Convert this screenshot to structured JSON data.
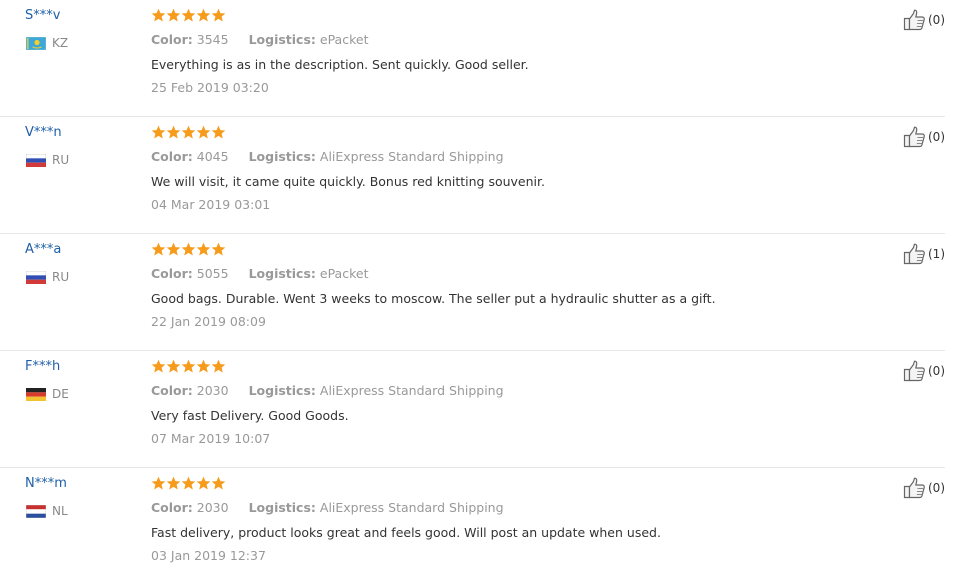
{
  "reviews": [
    {
      "user": "S***v",
      "country": "KZ",
      "flag": "kz",
      "stars": 5,
      "color_label": "Color:",
      "color_value": "3545",
      "logistics_label": "Logistics:",
      "logistics_value": "ePacket",
      "text": "Everything is as in the description. Sent quickly. Good seller.",
      "date": "25 Feb 2019 03:20",
      "helpful": "(0)"
    },
    {
      "user": "V***n",
      "country": "RU",
      "flag": "ru",
      "stars": 5,
      "color_label": "Color:",
      "color_value": "4045",
      "logistics_label": "Logistics:",
      "logistics_value": "AliExpress Standard Shipping",
      "text": "We will visit, it came quite quickly. Bonus red knitting souvenir.",
      "date": "04 Mar 2019 03:01",
      "helpful": "(0)"
    },
    {
      "user": "A***a",
      "country": "RU",
      "flag": "ru",
      "stars": 5,
      "color_label": "Color:",
      "color_value": "5055",
      "logistics_label": "Logistics:",
      "logistics_value": "ePacket",
      "text": "Good bags. Durable. Went 3 weeks to moscow. The seller put a hydraulic shutter as a gift.",
      "date": "22 Jan 2019 08:09",
      "helpful": "(1)"
    },
    {
      "user": "F***h",
      "country": "DE",
      "flag": "de",
      "stars": 5,
      "color_label": "Color:",
      "color_value": "2030",
      "logistics_label": "Logistics:",
      "logistics_value": "AliExpress Standard Shipping",
      "text": "Very fast Delivery. Good Goods.",
      "date": "07 Mar 2019 10:07",
      "helpful": "(0)"
    },
    {
      "user": "N***m",
      "country": "NL",
      "flag": "nl",
      "stars": 5,
      "color_label": "Color:",
      "color_value": "2030",
      "logistics_label": "Logistics:",
      "logistics_value": "AliExpress Standard Shipping",
      "text": "Fast delivery, product looks great and feels good. Will post an update when used.",
      "date": "03 Jan 2019 12:37",
      "helpful": "(0)"
    }
  ],
  "icons": {
    "star": "star-icon",
    "helpful": "thumbs-up-icon"
  },
  "colors": {
    "user_name": "#1f5fa8",
    "star": "#f79b1c",
    "muted": "#999999",
    "text": "#333333",
    "divider": "#e6e6e6"
  }
}
